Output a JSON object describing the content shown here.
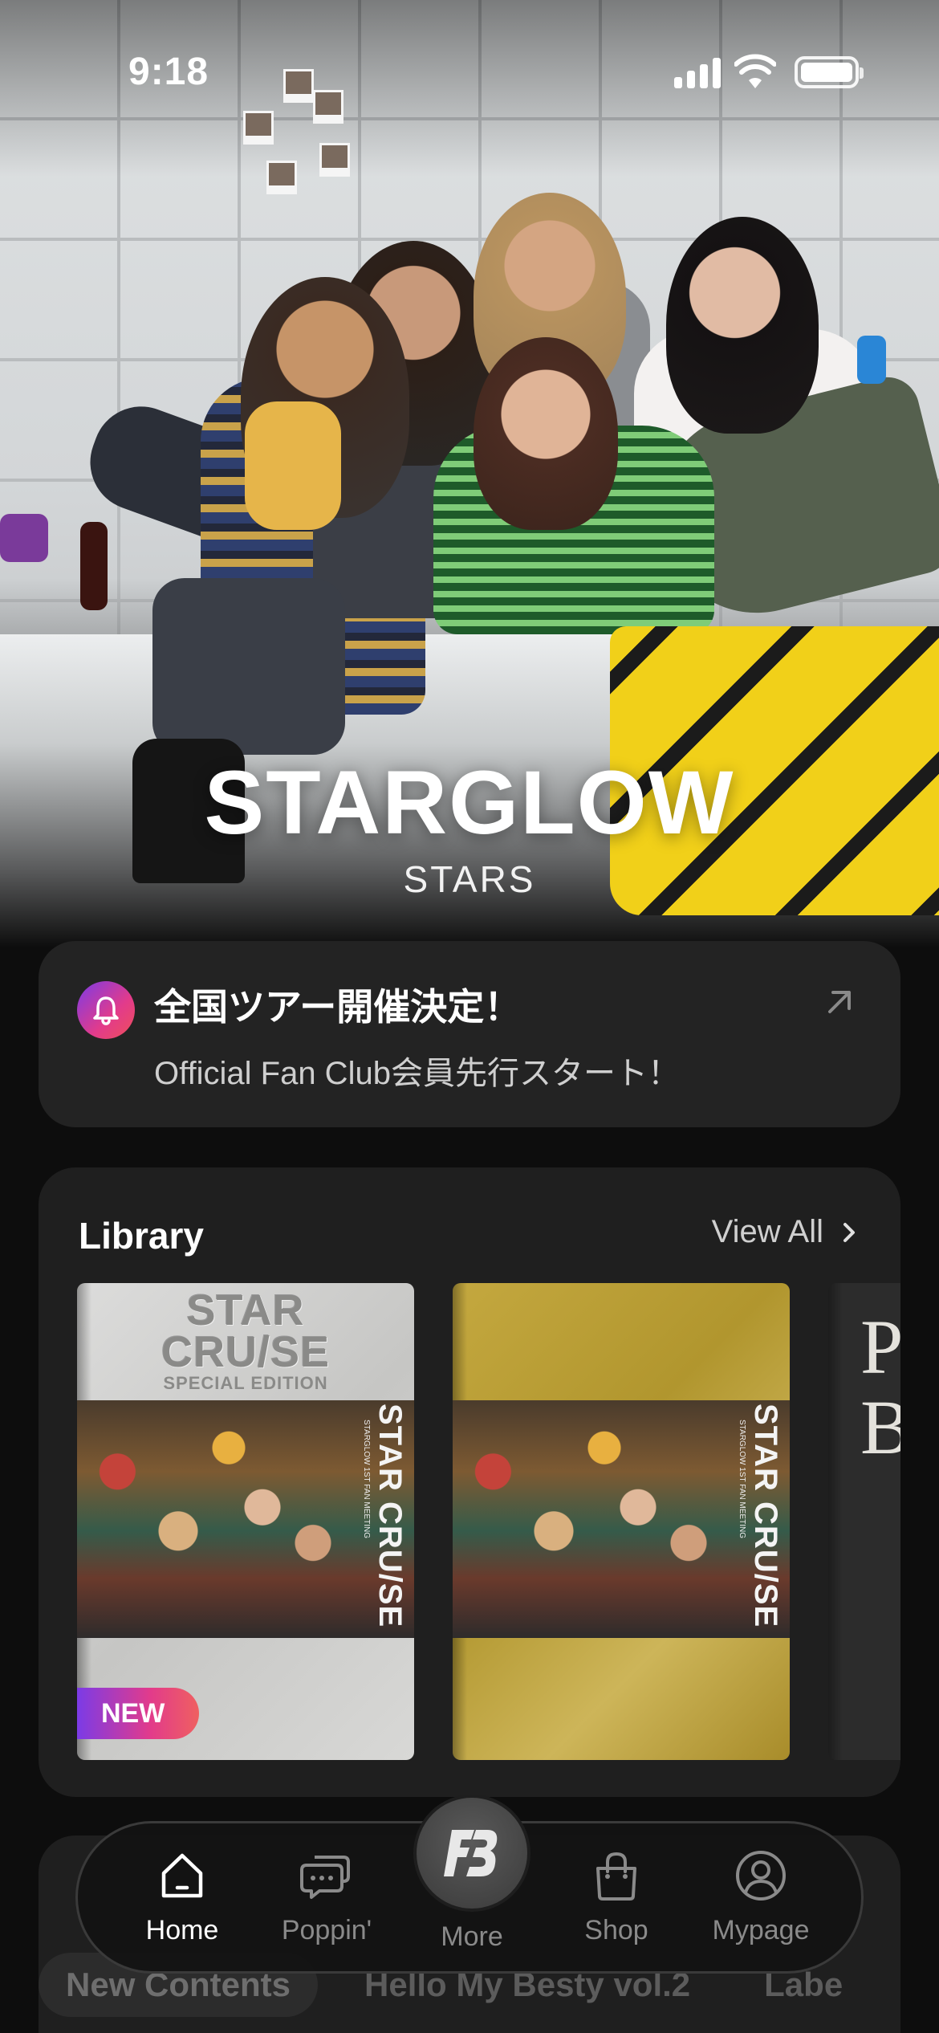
{
  "status_bar": {
    "time": "9:18"
  },
  "hero": {
    "artist_name": "STARGLOW",
    "artist_subtitle": "STARS"
  },
  "notice": {
    "title": "全国ツアー開催決定！",
    "subtitle": "Official Fan Club会員先行スタート！",
    "icon": "bell-icon",
    "action_icon": "arrow-up-right-icon"
  },
  "library": {
    "title": "Library",
    "view_all": "View All",
    "books": [
      {
        "cover_title": "STAR\nCRU/SE",
        "cover_edition": "SPECIAL EDITION",
        "side_text": "STAR CRU/SE",
        "side_small": "STARGLOW 1ST FAN MEETING",
        "badge": "NEW"
      },
      {
        "side_text": "STAR CRU/SE",
        "side_small": "STARGLOW 1ST FAN MEETING"
      },
      {
        "cover_text": "P\nB"
      }
    ]
  },
  "next_section": {
    "tabs": [
      "New Contents",
      "Hello My Besty vol.2",
      "Labe"
    ]
  },
  "bottom_nav": {
    "items": [
      {
        "label": "Home",
        "icon": "home-icon",
        "active": true
      },
      {
        "label": "Poppin'",
        "icon": "chat-bubbles-icon",
        "active": false
      },
      {
        "label": "More",
        "icon": "fb-logo-icon",
        "active": false
      },
      {
        "label": "Shop",
        "icon": "shopping-bag-icon",
        "active": false
      },
      {
        "label": "Mypage",
        "icon": "user-icon",
        "active": false
      }
    ]
  },
  "colors": {
    "background": "#0d0d0d",
    "card": "#232323",
    "accent_gradient_start": "#7b3be6",
    "accent_gradient_end": "#ef4f5a"
  }
}
